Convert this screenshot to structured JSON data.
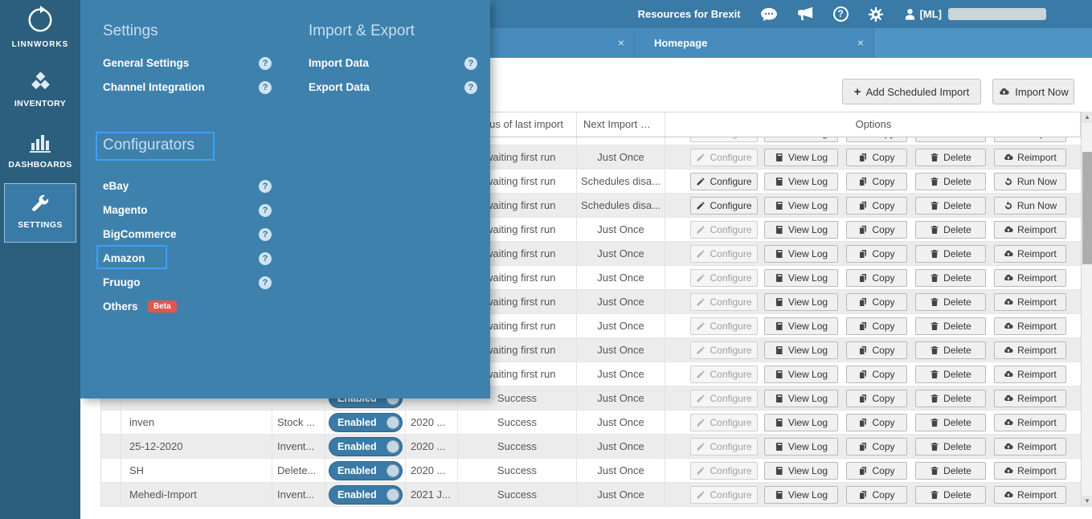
{
  "sidebar": {
    "logo": {
      "label": "LINNWORKS",
      "icon": "linnworks-logo-icon"
    },
    "items": [
      {
        "label": "INVENTORY",
        "icon": "inventory-boxes-icon",
        "selected": false
      },
      {
        "label": "DASHBOARDS",
        "icon": "bar-chart-icon",
        "selected": false
      },
      {
        "label": "SETTINGS",
        "icon": "wrench-icon",
        "selected": true
      }
    ]
  },
  "topbar": {
    "resources_link": "Resources for Brexit",
    "user_label": "[ML]",
    "icons": [
      "chat-bubble-icon",
      "megaphone-icon",
      "help-circle-icon",
      "gear-icon",
      "user-icon"
    ]
  },
  "tab_bar": {
    "tabs": [
      {
        "label": "",
        "closable": true
      },
      {
        "label": "Homepage",
        "closable": true
      }
    ]
  },
  "mega_menu": {
    "columns": [
      {
        "sections": [
          {
            "title": "Settings",
            "highlighted": false,
            "items": [
              {
                "label": "General Settings",
                "help": true
              },
              {
                "label": "Channel Integration",
                "help": true
              }
            ]
          },
          {
            "title": "Configurators",
            "highlighted": true,
            "items": [
              {
                "label": "eBay",
                "help": true
              },
              {
                "label": "Magento",
                "help": true
              },
              {
                "label": "BigCommerce",
                "help": true
              },
              {
                "label": "Amazon",
                "help": true,
                "highlighted": true
              },
              {
                "label": "Fruugo",
                "help": true
              },
              {
                "label": "Others",
                "help": false,
                "badge": "Beta"
              }
            ]
          }
        ]
      },
      {
        "sections": [
          {
            "title": "Import & Export",
            "highlighted": false,
            "items": [
              {
                "label": "Import Data",
                "help": true
              },
              {
                "label": "Export Data",
                "help": true
              }
            ]
          }
        ]
      }
    ]
  },
  "toolbar": {
    "add_scheduled_import": "Add Scheduled Import",
    "import_now": "Import Now"
  },
  "table": {
    "headers": {
      "status": "Status of last import",
      "next_import": "Next Import Due",
      "options": "Options"
    },
    "option_labels": {
      "configure": "Configure",
      "view_log": "View Log",
      "copy": "Copy",
      "delete": "Delete",
      "reimport": "Reimport",
      "run_now": "Run Now"
    },
    "toggle_label": "Enabled",
    "rows": [
      {
        "partial": true,
        "name": "",
        "type": "",
        "enabled": false,
        "date": "",
        "status": "",
        "next_import": "",
        "configure_enabled": false,
        "last_action": "Reimport"
      },
      {
        "name": "",
        "type": "",
        "enabled": false,
        "date": "",
        "status": "Awaiting first run",
        "next_import": "Just Once",
        "configure_enabled": false,
        "last_action": "Reimport"
      },
      {
        "name": "",
        "type": "",
        "enabled": false,
        "date": "",
        "status": "Awaiting first run",
        "next_import": "Schedules disa...",
        "configure_enabled": true,
        "last_action": "Run Now"
      },
      {
        "name": "",
        "type": "",
        "enabled": false,
        "date": "",
        "status": "Awaiting first run",
        "next_import": "Schedules disa...",
        "configure_enabled": true,
        "last_action": "Run Now"
      },
      {
        "name": "",
        "type": "",
        "enabled": false,
        "date": "",
        "status": "Awaiting first run",
        "next_import": "Just Once",
        "configure_enabled": false,
        "last_action": "Reimport"
      },
      {
        "name": "",
        "type": "",
        "enabled": false,
        "date": "",
        "status": "Awaiting first run",
        "next_import": "Just Once",
        "configure_enabled": false,
        "last_action": "Reimport"
      },
      {
        "name": "",
        "type": "",
        "enabled": false,
        "date": "",
        "status": "Awaiting first run",
        "next_import": "Just Once",
        "configure_enabled": false,
        "last_action": "Reimport"
      },
      {
        "name": "",
        "type": "",
        "enabled": false,
        "date": "",
        "status": "Awaiting first run",
        "next_import": "Just Once",
        "configure_enabled": false,
        "last_action": "Reimport"
      },
      {
        "name": "",
        "type": "",
        "enabled": false,
        "date": "",
        "status": "Awaiting first run",
        "next_import": "Just Once",
        "configure_enabled": false,
        "last_action": "Reimport"
      },
      {
        "name": "",
        "type": "",
        "enabled": false,
        "date": "",
        "status": "Awaiting first run",
        "next_import": "Just Once",
        "configure_enabled": false,
        "last_action": "Reimport"
      },
      {
        "name": "",
        "type": "",
        "enabled": false,
        "date": "",
        "status": "Awaiting first run",
        "next_import": "Just Once",
        "configure_enabled": false,
        "last_action": "Reimport"
      },
      {
        "name": "",
        "type": "",
        "enabled": true,
        "date": "",
        "status": "Success",
        "next_import": "Just Once",
        "configure_enabled": false,
        "last_action": "Reimport"
      },
      {
        "name": "inven",
        "type": "Stock ...",
        "enabled": true,
        "date": "2020 ...",
        "status": "Success",
        "next_import": "Just Once",
        "configure_enabled": false,
        "last_action": "Reimport"
      },
      {
        "name": "25-12-2020",
        "type": "Invent...",
        "enabled": true,
        "date": "2020 ...",
        "status": "Success",
        "next_import": "Just Once",
        "configure_enabled": false,
        "last_action": "Reimport"
      },
      {
        "name": "SH",
        "type": "Delete...",
        "enabled": true,
        "date": "2020 ...",
        "status": "Success",
        "next_import": "Just Once",
        "configure_enabled": false,
        "last_action": "Reimport"
      },
      {
        "name": "Mehedi-Import",
        "type": "Invent...",
        "enabled": true,
        "date": "2021 J...",
        "status": "Success",
        "next_import": "Just Once",
        "configure_enabled": false,
        "last_action": "Reimport"
      }
    ]
  },
  "glyphs": {
    "help": "?",
    "close": "×",
    "plus": "+",
    "up_arrow": "▲",
    "down_arrow": "▼"
  },
  "colors": {
    "sidebar_bg": "#2c5f7e",
    "topbar_bg": "#3a7aa6",
    "tabbar_bg": "#4e95c3",
    "menu_bg": "#3e81ad",
    "highlight_border": "#3da0f2",
    "beta_badge_bg": "#e2574d",
    "toggle_bg": "#3a7aa6"
  }
}
